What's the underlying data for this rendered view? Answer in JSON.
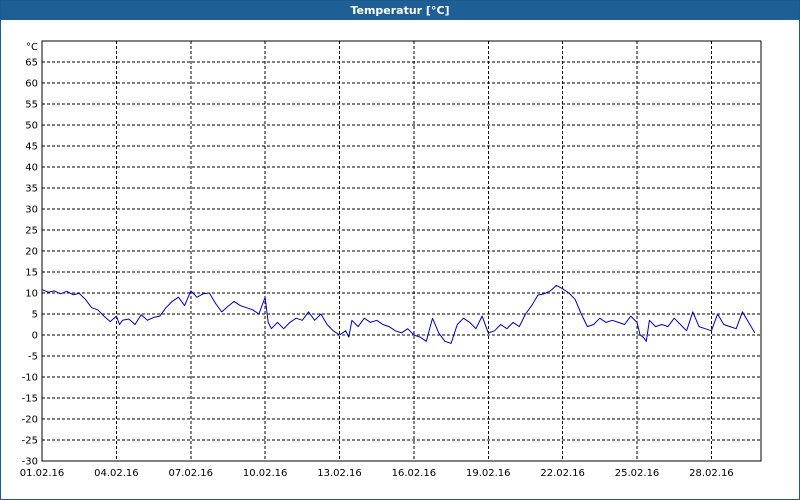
{
  "window": {
    "title": "Temperatur [°C]"
  },
  "colors": {
    "titlebar": "#1e5f96",
    "series": "#0000c0",
    "grid": "#000000"
  },
  "chart_data": {
    "type": "line",
    "title": "Temperatur [°C]",
    "unit_label": "°C",
    "xlabel": "",
    "ylabel": "",
    "grid": true,
    "ylim": [
      -30,
      70
    ],
    "yticks": [
      -30,
      -25,
      -20,
      -15,
      -10,
      -5,
      0,
      5,
      10,
      15,
      20,
      25,
      30,
      35,
      40,
      45,
      50,
      55,
      60,
      65
    ],
    "xlim": [
      "01.02.16",
      "29.02.16 24:00"
    ],
    "xticks": [
      "01.02.16",
      "04.02.16",
      "07.02.16",
      "10.02.16",
      "13.02.16",
      "16.02.16",
      "19.02.16",
      "22.02.16",
      "25.02.16",
      "28.02.16"
    ],
    "series": [
      {
        "name": "",
        "color": "#0000c0",
        "points": [
          [
            "01.02.16 00:00",
            10.8
          ],
          [
            "01.02.16 06:00",
            10.2
          ],
          [
            "01.02.16 12:00",
            10.5
          ],
          [
            "01.02.16 18:00",
            9.8
          ],
          [
            "02.02.16 00:00",
            10.4
          ],
          [
            "02.02.16 06:00",
            9.6
          ],
          [
            "02.02.16 12:00",
            9.9
          ],
          [
            "02.02.16 18:00",
            8.5
          ],
          [
            "03.02.16 00:00",
            6.5
          ],
          [
            "03.02.16 06:00",
            6.0
          ],
          [
            "03.02.16 12:00",
            4.5
          ],
          [
            "03.02.16 18:00",
            3.2
          ],
          [
            "04.02.16 00:00",
            4.5
          ],
          [
            "04.02.16 03:00",
            2.5
          ],
          [
            "04.02.16 06:00",
            3.5
          ],
          [
            "04.02.16 12:00",
            3.8
          ],
          [
            "04.02.16 18:00",
            2.5
          ],
          [
            "05.02.16 00:00",
            4.8
          ],
          [
            "05.02.16 06:00",
            3.5
          ],
          [
            "05.02.16 12:00",
            4.2
          ],
          [
            "05.02.16 18:00",
            4.5
          ],
          [
            "06.02.16 00:00",
            6.5
          ],
          [
            "06.02.16 06:00",
            8.0
          ],
          [
            "06.02.16 12:00",
            9.0
          ],
          [
            "06.02.16 18:00",
            7.0
          ],
          [
            "07.02.16 00:00",
            10.5
          ],
          [
            "07.02.16 06:00",
            9.0
          ],
          [
            "07.02.16 12:00",
            9.8
          ],
          [
            "07.02.16 18:00",
            10.0
          ],
          [
            "08.02.16 00:00",
            7.5
          ],
          [
            "08.02.16 06:00",
            5.5
          ],
          [
            "08.02.16 12:00",
            6.8
          ],
          [
            "08.02.16 18:00",
            8.0
          ],
          [
            "09.02.16 00:00",
            7.0
          ],
          [
            "09.02.16 06:00",
            6.5
          ],
          [
            "09.02.16 12:00",
            6.0
          ],
          [
            "09.02.16 18:00",
            5.0
          ],
          [
            "10.02.16 00:00",
            9.0
          ],
          [
            "10.02.16 03:00",
            3.0
          ],
          [
            "10.02.16 06:00",
            1.5
          ],
          [
            "10.02.16 12:00",
            3.0
          ],
          [
            "10.02.16 18:00",
            1.5
          ],
          [
            "11.02.16 00:00",
            3.0
          ],
          [
            "11.02.16 06:00",
            4.0
          ],
          [
            "11.02.16 12:00",
            3.5
          ],
          [
            "11.02.16 18:00",
            5.5
          ],
          [
            "12.02.16 00:00",
            3.5
          ],
          [
            "12.02.16 06:00",
            5.0
          ],
          [
            "12.02.16 12:00",
            2.5
          ],
          [
            "12.02.16 18:00",
            1.0
          ],
          [
            "13.02.16 00:00",
            0.0
          ],
          [
            "13.02.16 06:00",
            1.0
          ],
          [
            "13.02.16 09:00",
            -0.5
          ],
          [
            "13.02.16 12:00",
            3.5
          ],
          [
            "13.02.16 18:00",
            2.0
          ],
          [
            "14.02.16 00:00",
            4.0
          ],
          [
            "14.02.16 06:00",
            3.0
          ],
          [
            "14.02.16 12:00",
            3.5
          ],
          [
            "14.02.16 18:00",
            2.5
          ],
          [
            "15.02.16 00:00",
            2.0
          ],
          [
            "15.02.16 06:00",
            1.0
          ],
          [
            "15.02.16 12:00",
            0.5
          ],
          [
            "15.02.16 18:00",
            1.5
          ],
          [
            "16.02.16 00:00",
            0.0
          ],
          [
            "16.02.16 06:00",
            -0.5
          ],
          [
            "16.02.16 12:00",
            -1.5
          ],
          [
            "16.02.16 18:00",
            4.0
          ],
          [
            "17.02.16 00:00",
            0.5
          ],
          [
            "17.02.16 06:00",
            -1.5
          ],
          [
            "17.02.16 12:00",
            -2.0
          ],
          [
            "17.02.16 18:00",
            2.5
          ],
          [
            "18.02.16 00:00",
            4.0
          ],
          [
            "18.02.16 06:00",
            3.0
          ],
          [
            "18.02.16 12:00",
            1.5
          ],
          [
            "18.02.16 18:00",
            4.5
          ],
          [
            "19.02.16 00:00",
            0.5
          ],
          [
            "19.02.16 06:00",
            1.0
          ],
          [
            "19.02.16 12:00",
            2.5
          ],
          [
            "19.02.16 18:00",
            1.5
          ],
          [
            "20.02.16 00:00",
            3.0
          ],
          [
            "20.02.16 06:00",
            2.0
          ],
          [
            "20.02.16 12:00",
            5.0
          ],
          [
            "20.02.16 18:00",
            7.0
          ],
          [
            "21.02.16 00:00",
            9.5
          ],
          [
            "21.02.16 06:00",
            9.8
          ],
          [
            "21.02.16 12:00",
            10.5
          ],
          [
            "21.02.16 18:00",
            11.8
          ],
          [
            "22.02.16 00:00",
            11.0
          ],
          [
            "22.02.16 06:00",
            10.0
          ],
          [
            "22.02.16 12:00",
            8.5
          ],
          [
            "22.02.16 18:00",
            5.0
          ],
          [
            "23.02.16 00:00",
            2.0
          ],
          [
            "23.02.16 06:00",
            2.5
          ],
          [
            "23.02.16 12:00",
            4.0
          ],
          [
            "23.02.16 18:00",
            3.0
          ],
          [
            "24.02.16 00:00",
            3.5
          ],
          [
            "24.02.16 06:00",
            3.0
          ],
          [
            "24.02.16 12:00",
            2.5
          ],
          [
            "24.02.16 18:00",
            4.5
          ],
          [
            "25.02.16 00:00",
            3.0
          ],
          [
            "25.02.16 03:00",
            0.0
          ],
          [
            "25.02.16 06:00",
            -0.5
          ],
          [
            "25.02.16 09:00",
            -1.5
          ],
          [
            "25.02.16 12:00",
            3.5
          ],
          [
            "25.02.16 18:00",
            2.0
          ],
          [
            "26.02.16 00:00",
            2.5
          ],
          [
            "26.02.16 06:00",
            2.0
          ],
          [
            "26.02.16 12:00",
            4.0
          ],
          [
            "26.02.16 18:00",
            2.5
          ],
          [
            "27.02.16 00:00",
            1.0
          ],
          [
            "27.02.16 06:00",
            5.5
          ],
          [
            "27.02.16 12:00",
            2.0
          ],
          [
            "27.02.16 18:00",
            1.5
          ],
          [
            "28.02.16 00:00",
            1.0
          ],
          [
            "28.02.16 06:00",
            5.0
          ],
          [
            "28.02.16 12:00",
            2.5
          ],
          [
            "28.02.16 18:00",
            2.0
          ],
          [
            "29.02.16 00:00",
            1.5
          ],
          [
            "29.02.16 06:00",
            5.5
          ],
          [
            "29.02.16 12:00",
            3.0
          ],
          [
            "29.02.16 18:00",
            0.5
          ]
        ]
      }
    ]
  }
}
